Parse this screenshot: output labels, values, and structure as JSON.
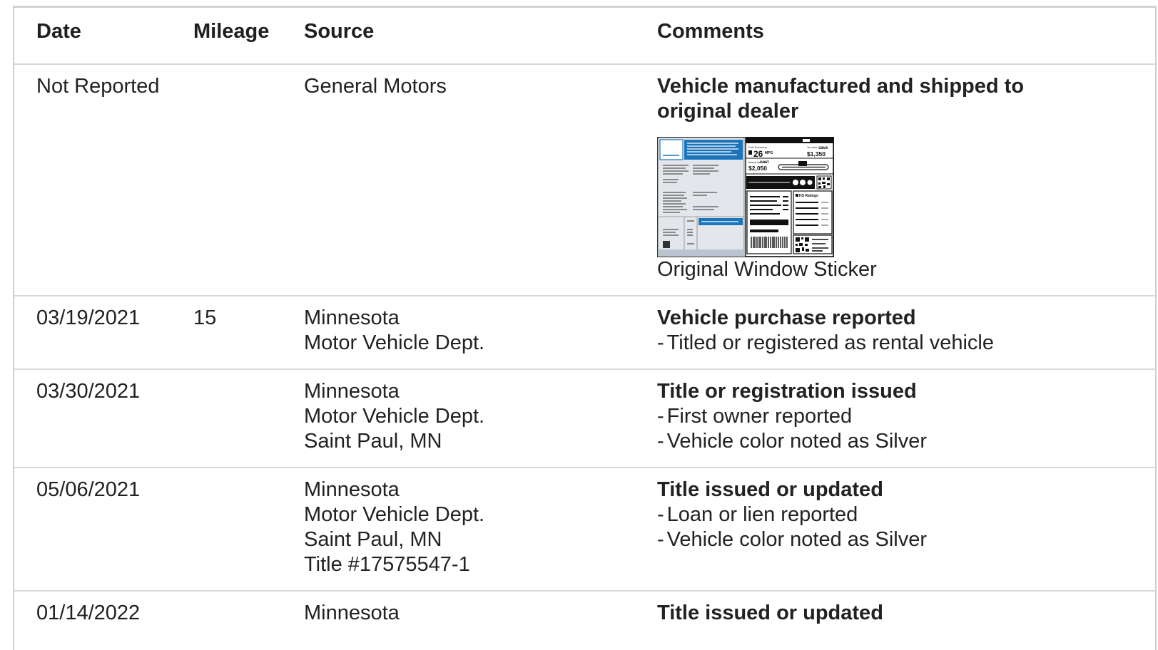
{
  "table": {
    "headers": {
      "date": "Date",
      "mileage": "Mileage",
      "source": "Source",
      "comments": "Comments"
    },
    "rows": [
      {
        "date": "Not Reported",
        "mileage": "",
        "source": [
          "General Motors"
        ],
        "title": "Vehicle manufactured and shipped to original dealer",
        "items": [],
        "sticker": {
          "caption": "Original Window Sticker",
          "fuel_economy_label": "Fuel Economy",
          "mpg_value": "26",
          "mpg_unit": "MPG",
          "save_label": "You save",
          "save_word": "save",
          "save_amount": "$1,350",
          "annual_cost_label": "Annual fuel cost",
          "cost_word": "cost",
          "cost_amount": "$2,050",
          "ratings_label": "HS Ratings",
          "accent_color": "#1b75bb"
        }
      },
      {
        "date": "03/19/2021",
        "mileage": "15",
        "source": [
          "Minnesota",
          "Motor Vehicle Dept."
        ],
        "title": "Vehicle purchase reported",
        "items": [
          "Titled or registered as rental vehicle"
        ]
      },
      {
        "date": "03/30/2021",
        "mileage": "",
        "source": [
          "Minnesota",
          "Motor Vehicle Dept.",
          "Saint Paul, MN"
        ],
        "title": "Title or registration issued",
        "items": [
          "First owner reported",
          "Vehicle color noted as Silver"
        ]
      },
      {
        "date": "05/06/2021",
        "mileage": "",
        "source": [
          "Minnesota",
          "Motor Vehicle Dept.",
          "Saint Paul, MN",
          "Title #17575547-1"
        ],
        "title": "Title issued or updated",
        "items": [
          "Loan or lien reported",
          "Vehicle color noted as Silver"
        ]
      },
      {
        "date": "01/14/2022",
        "mileage": "",
        "source": [
          "Minnesota"
        ],
        "title": "Title issued or updated",
        "items": []
      }
    ]
  }
}
